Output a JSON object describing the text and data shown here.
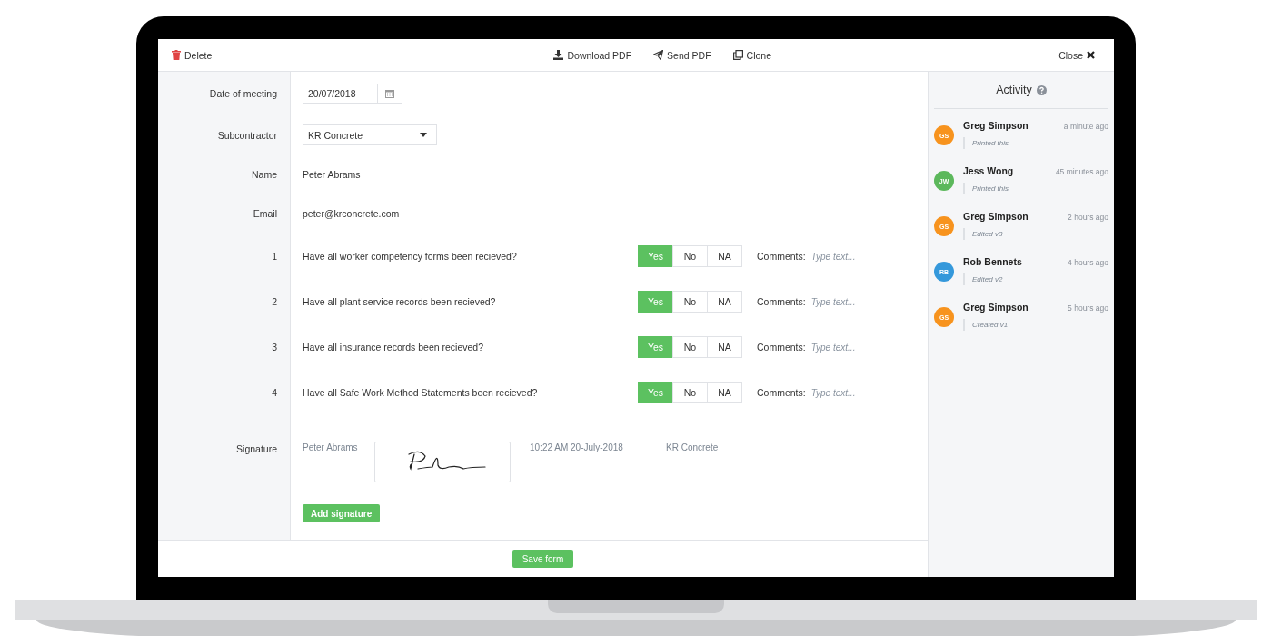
{
  "toolbar": {
    "delete": "Delete",
    "actions": [
      {
        "kind": "download",
        "label": "Download PDF"
      },
      {
        "kind": "send",
        "label": "Send PDF"
      },
      {
        "kind": "clone",
        "label": "Clone"
      }
    ],
    "close": "Close"
  },
  "fields": [
    {
      "kind": "date",
      "label": "Date of meeting",
      "value": "20/07/2018"
    },
    {
      "kind": "select",
      "label": "Subcontractor",
      "value": "KR Concrete"
    },
    {
      "kind": "text",
      "label": "Name",
      "value": "Peter Abrams"
    },
    {
      "kind": "text",
      "label": "Email",
      "value": "peter@krconcrete.com"
    }
  ],
  "questions": [
    {
      "number": "1",
      "text": "Have all worker competency forms been recieved?",
      "options": [
        {
          "label": "Yes",
          "selected": true
        },
        {
          "label": "No",
          "selected": false
        },
        {
          "label": "NA",
          "selected": false
        }
      ],
      "comments_label": "Comments:",
      "placeholder": "Type text..."
    },
    {
      "number": "2",
      "text": "Have all plant service records been recieved?",
      "options": [
        {
          "label": "Yes",
          "selected": true
        },
        {
          "label": "No",
          "selected": false
        },
        {
          "label": "NA",
          "selected": false
        }
      ],
      "comments_label": "Comments:",
      "placeholder": "Type text..."
    },
    {
      "number": "3",
      "text": "Have all insurance records been recieved?",
      "options": [
        {
          "label": "Yes",
          "selected": true
        },
        {
          "label": "No",
          "selected": false
        },
        {
          "label": "NA",
          "selected": false
        }
      ],
      "comments_label": "Comments:",
      "placeholder": "Type text..."
    },
    {
      "number": "4",
      "text": "Have all Safe Work Method Statements been recieved?",
      "options": [
        {
          "label": "Yes",
          "selected": true
        },
        {
          "label": "No",
          "selected": false
        },
        {
          "label": "NA",
          "selected": false
        }
      ],
      "comments_label": "Comments:",
      "placeholder": "Type text..."
    }
  ],
  "signature": {
    "label": "Signature",
    "signer": "Peter Abrams",
    "timestamp": "10:22 AM 20-July-2018",
    "company": "KR Concrete",
    "add_button": "Add signature"
  },
  "save_button": "Save form",
  "activity": {
    "title": "Activity",
    "entries": [
      {
        "initials": "GS",
        "color": "#f7931e",
        "name": "Greg Simpson",
        "time": "a minute ago",
        "note": "Printed this"
      },
      {
        "initials": "JW",
        "color": "#5cb85c",
        "name": "Jess Wong",
        "time": "45 minutes ago",
        "note": "Printed this"
      },
      {
        "initials": "GS",
        "color": "#f7931e",
        "name": "Greg Simpson",
        "time": "2 hours ago",
        "note": "Edited v3"
      },
      {
        "initials": "RB",
        "color": "#3498db",
        "name": "Rob Bennets",
        "time": "4 hours ago",
        "note": "Edited v2"
      },
      {
        "initials": "GS",
        "color": "#f7931e",
        "name": "Greg Simpson",
        "time": "5 hours ago",
        "note": "Created v1"
      }
    ]
  }
}
